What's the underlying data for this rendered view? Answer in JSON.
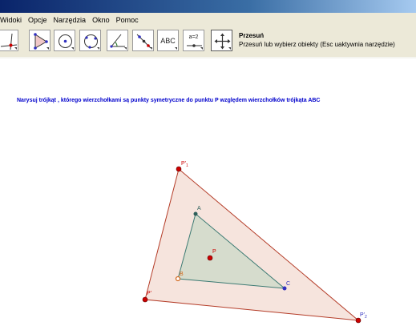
{
  "menu": {
    "items": [
      "Widoki",
      "Opcje",
      "Narzędzia",
      "Okno",
      "Pomoc"
    ]
  },
  "toolbar": {
    "tools": [
      {
        "name": "intersect-lines-tool-icon"
      },
      {
        "name": "polygon-tool-icon"
      },
      {
        "name": "circle-center-point-tool-icon"
      },
      {
        "name": "circle-through-points-tool-icon"
      },
      {
        "name": "angle-tool-icon"
      },
      {
        "name": "reflect-about-point-tool-icon"
      },
      {
        "name": "text-tool-icon",
        "label": "ABC"
      },
      {
        "name": "slider-tool-icon",
        "label": "a=2"
      },
      {
        "name": "move-graphics-view-tool-icon"
      }
    ],
    "active_tool_title": "Przesuń",
    "active_tool_help": "Przesuń lub wybierz obiekty (Esc uaktywnia narzędzie)"
  },
  "task_text": "Narysuj trójkąt , którego wierzchołkami są punkty symetryczne do punktu P względem wierzchołków trójkąta ABC",
  "colors": {
    "outer_triangle_fill": "#f6e4dd",
    "outer_triangle_stroke": "#b43c28",
    "inner_triangle_fill": "#d6dccd",
    "inner_triangle_stroke": "#3c7a73",
    "point_red": "#cc0000",
    "point_A": "#2e5f5a",
    "point_B": "#d2691e",
    "point_C": "#3030c0",
    "label_red": "#cc0000",
    "label_blue": "#3030c0",
    "label_orange": "#d2691e",
    "label_teal": "#2e5f5a"
  },
  "points": {
    "A": {
      "label": "A"
    },
    "B": {
      "label": "B"
    },
    "C": {
      "label": "C"
    },
    "P": {
      "label": "P"
    },
    "P1": {
      "label": "P'",
      "sub": "1"
    },
    "P2": {
      "label": "P'",
      "sub": "2"
    },
    "P3": {
      "label": "P'"
    }
  }
}
